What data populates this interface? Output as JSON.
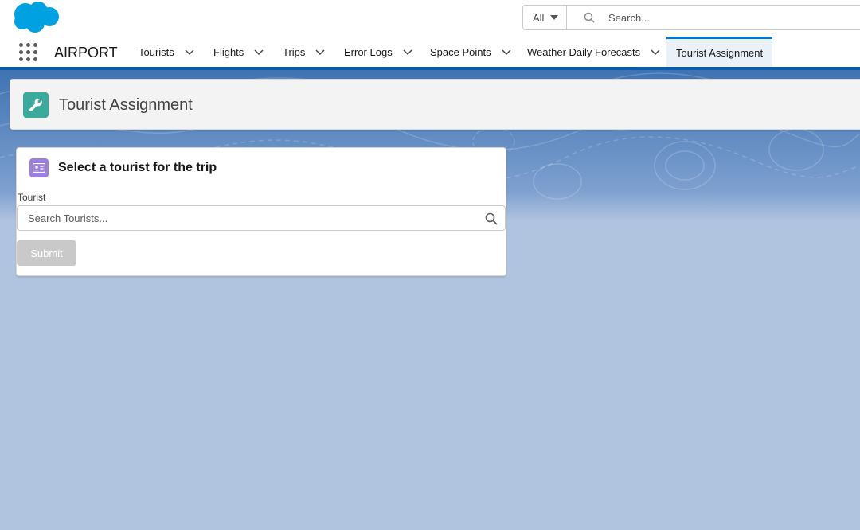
{
  "header": {
    "search": {
      "scope": "All",
      "placeholder": "Search..."
    }
  },
  "nav": {
    "app_name": "AIRPORT",
    "items": [
      {
        "label": "Tourists"
      },
      {
        "label": "Flights"
      },
      {
        "label": "Trips"
      },
      {
        "label": "Error Logs"
      },
      {
        "label": "Space Points"
      },
      {
        "label": "Weather Daily Forecasts"
      },
      {
        "label": "Tourist Assignment",
        "active": true
      }
    ]
  },
  "page": {
    "title": "Tourist Assignment",
    "icon": "wrench-icon"
  },
  "card": {
    "icon": "contact-card-icon",
    "title": "Select a tourist for the trip",
    "field_label": "Tourist",
    "lookup_placeholder": "Search Tourists...",
    "submit_label": "Submit"
  },
  "colors": {
    "brand": "#0176d3",
    "page_icon_bg": "#3ba99c",
    "card_icon_bg": "#9d7fe3",
    "background": "#b0c4df"
  }
}
